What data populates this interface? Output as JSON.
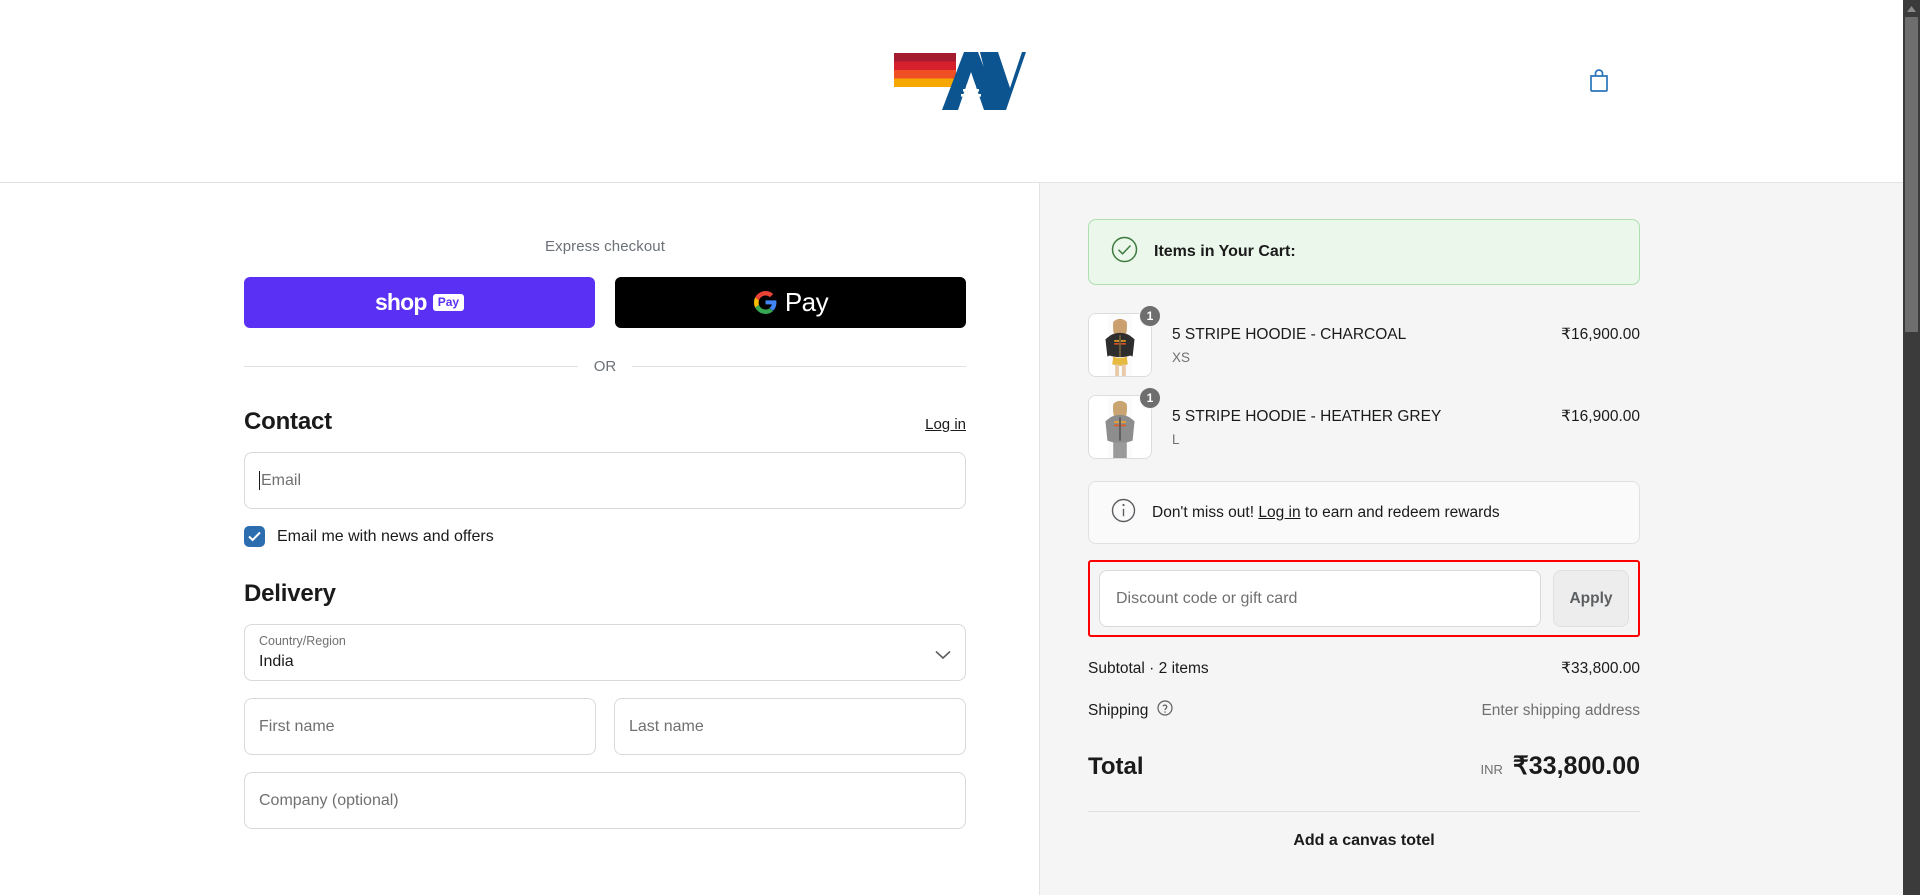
{
  "header": {
    "logo_alt": "AV logo",
    "cart_icon": "shopping-bag-icon"
  },
  "express": {
    "title": "Express checkout",
    "shop_pay": {
      "word": "shop",
      "badge": "Pay"
    },
    "google_pay": {
      "word": "Pay"
    },
    "divider": "OR"
  },
  "contact": {
    "title": "Contact",
    "login_label": "Log in",
    "email_placeholder": "Email",
    "email_value": "",
    "newsletter_label": "Email me with news and offers",
    "newsletter_checked": true
  },
  "delivery": {
    "title": "Delivery",
    "country": {
      "label": "Country/Region",
      "value": "India"
    },
    "first_name_placeholder": "First name",
    "last_name_placeholder": "Last name",
    "company_placeholder": "Company (optional)"
  },
  "summary": {
    "banner": {
      "text": "Items in Your Cart:",
      "icon": "check-circle-icon"
    },
    "items": [
      {
        "name": "5 STRIPE HOODIE - CHARCOAL",
        "variant": "XS",
        "price": "₹16,900.00",
        "qty": "1"
      },
      {
        "name": "5 STRIPE HOODIE - HEATHER GREY",
        "variant": "L",
        "price": "₹16,900.00",
        "qty": "1"
      }
    ],
    "rewards": {
      "prefix": "Don't miss out!",
      "link": "Log in",
      "suffix": "to earn and redeem rewards",
      "icon": "info-icon"
    },
    "discount": {
      "placeholder": "Discount code or gift card",
      "value": "",
      "apply_label": "Apply",
      "highlight_color": "#ff0000"
    },
    "subtotal": {
      "label": "Subtotal · 2 items",
      "value": "₹33,800.00"
    },
    "shipping": {
      "label": "Shipping",
      "value": "Enter shipping address",
      "icon": "help-icon"
    },
    "total": {
      "label": "Total",
      "currency": "INR",
      "value": "₹33,800.00"
    },
    "upsell": "Add a canvas totel"
  },
  "colors": {
    "shop_pay_purple": "#5a31f4",
    "gpay_black": "#000000",
    "checkbox_blue": "#2b6dae",
    "logo_blue": "#0b548f",
    "banner_green_bg": "#eaf7ea",
    "banner_green_border": "#afdfae",
    "panel_grey": "#f5f5f5"
  }
}
